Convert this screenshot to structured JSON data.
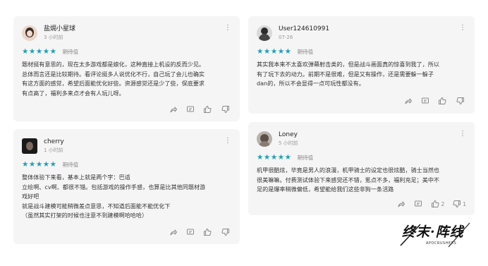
{
  "reviews": [
    {
      "user": "盐焗小星球",
      "time": "3 小时前",
      "stars": "★★★★★",
      "rating_label": "期待值",
      "text": "题材挺有意思的，现在太多游戏都是娘化，这种直接上机设的反而少见。\n总体而言还是比较期待。看评论挺多人说优化不行，自己玩了会儿也确实\n有这方面的感觉，希望后面能优化好些。资源感觉还是少了些，保底要求\n有点高了，福利多来点才会有人玩儿呀。",
      "likes": "",
      "dislikes": ""
    },
    {
      "user": "User124610991",
      "time": "07-26",
      "stars": "★★★★★",
      "rating_label": "期待值",
      "text": "其实我本来不太喜欢弹幕射击类的，但是战斗画面真的惊喜到我了，所以\n有了玩下去的动力。前期不是很难，但是又有操作，还是需要躲一躲子\ndan的，所以不会显得一点可玩性都没有。",
      "likes": "",
      "dislikes": ""
    },
    {
      "user": "cherry",
      "time": "1 小时前",
      "stars": "★★★★★",
      "rating_label": "期待值",
      "text": "整体体验下来看，基本上就是两个字：巴适\n立绘啊、cv啊、都很不错。包括游戏的操作手感，也算是比其他同题材游\n戏好吧\n就是战斗建模可能稍微差点意思，不知道后面能不能优化下\n（虽然其实打架的时候也注意不到建模啊哈哈哈）",
      "likes": "",
      "dislikes": ""
    },
    {
      "user": "Loney",
      "time": "5 小时前",
      "stars": "★★★★★",
      "rating_label": "期待值",
      "text": "机甲很酷炫，毕竟是男人的浪漫，机甲骑士的设定也很炫酷，骑士当然也\n很美嘛嘛。付费测试体验下来感觉还不错，氪点不多，福利充足；美中不\n足的是爆率稍微偏低，希望能给我们这些非狗一条活路",
      "likes": "2",
      "dislikes": "1"
    }
  ],
  "logo": {
    "main": "终末·阵线",
    "sub": "APOCRUSHERS"
  },
  "colors": {
    "card_bg": "#f5f5f6",
    "star": "#1f9fb3"
  }
}
